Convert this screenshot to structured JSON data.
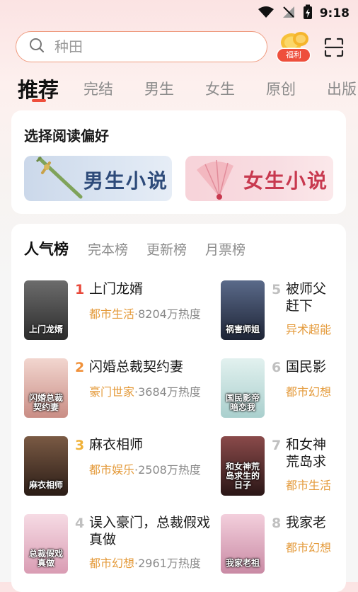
{
  "status_bar": {
    "time": "9:18"
  },
  "search": {
    "placeholder": "种田"
  },
  "welfare": {
    "label": "福利"
  },
  "tabs": [
    {
      "label": "推荐"
    },
    {
      "label": "完结"
    },
    {
      "label": "男生"
    },
    {
      "label": "女生"
    },
    {
      "label": "原创"
    },
    {
      "label": "出版"
    }
  ],
  "preference": {
    "title": "选择阅读偏好",
    "male_label": "男生小说",
    "female_label": "女生小说"
  },
  "rank": {
    "tabs": [
      {
        "label": "人气榜"
      },
      {
        "label": "完本榜"
      },
      {
        "label": "更新榜"
      },
      {
        "label": "月票榜"
      }
    ],
    "books": [
      {
        "rank": "1",
        "title": "上门龙婿",
        "genre": "都市生活",
        "heat": "·8204万热度",
        "cover_text": "上门龙婿",
        "cover_color": "#3a3a3a"
      },
      {
        "rank": "2",
        "title": "闪婚总裁契约妻",
        "genre": "豪门世家",
        "heat": "·3684万热度",
        "cover_text": "闪婚总裁契约妻",
        "cover_color": "#d8a7a0"
      },
      {
        "rank": "3",
        "title": "麻衣相师",
        "genre": "都市娱乐",
        "heat": "·2508万热度",
        "cover_text": "麻衣相师",
        "cover_color": "#3b2a22"
      },
      {
        "rank": "4",
        "title": "误入豪门，总裁假戏真做",
        "genre": "都市幻想",
        "heat": "·2961万热度",
        "cover_text": "总裁假戏真做",
        "cover_color": "#e2b6c6"
      },
      {
        "rank": "5",
        "title": "被师父赶下山，我祸害师姐",
        "genre": "异术超能",
        "heat": "",
        "cover_text": "祸害师姐",
        "cover_color": "#2a3244"
      },
      {
        "rank": "6",
        "title": "国民影帝暗恋我",
        "genre": "都市幻想",
        "heat": "",
        "cover_text": "国民影帝暗恋我",
        "cover_color": "#cfe6e6"
      },
      {
        "rank": "7",
        "title": "和女神荒岛求生的日子",
        "genre": "都市生活",
        "heat": "",
        "cover_text": "和女神荒岛求生的日子",
        "cover_color": "#3a2424"
      },
      {
        "rank": "8",
        "title": "我家老祖是大佬",
        "genre": "都市幻想",
        "heat": "",
        "cover_text": "我家老祖",
        "cover_color": "#e6b8c8"
      }
    ]
  },
  "colors": {
    "accent": "#ee4f3c",
    "genre": "#e49a3a"
  }
}
